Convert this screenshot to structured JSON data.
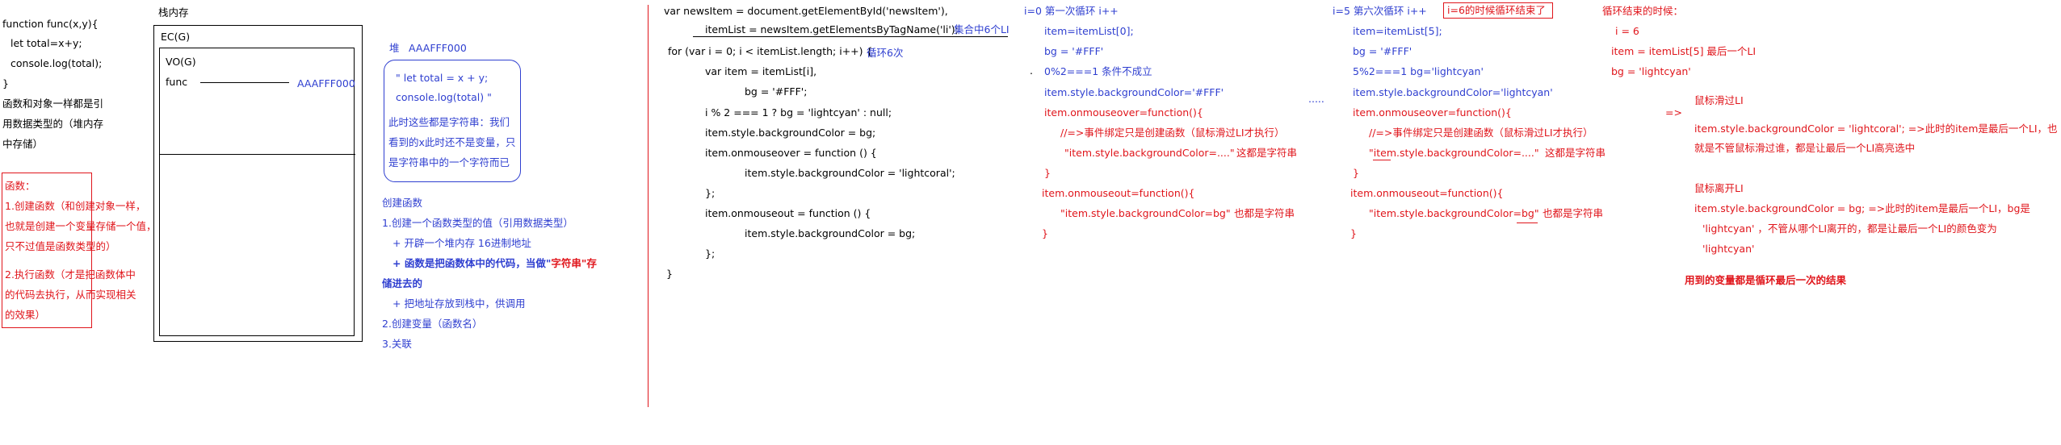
{
  "colors": {
    "text": "#000000",
    "blue": "#2f3fd0",
    "red": "#e0151b"
  },
  "col1": {
    "lines": [
      "function func(x,y){",
      "let total=x+y;",
      "console.log(total);",
      "}",
      "函数和对象一样都是引",
      "用数据类型的（堆内存",
      "中存储）"
    ],
    "box": [
      "函数：",
      "1.创建函数（和创建对象一样，",
      "也就是创建一个变量存储一个值，",
      "只不过值是函数类型的）",
      "2.执行函数（才是把函数体中",
      "的代码去执行，从而实现相关",
      "的效果）"
    ]
  },
  "stack": {
    "title": "栈内存",
    "ec": "EC(G)",
    "vo": "VO(G)",
    "func": "func",
    "addr": "AAAFFF000"
  },
  "heap": {
    "label": "堆",
    "addr": "AAAFFF000",
    "code1": "\" let total = x + y;",
    "code2": "console.log(total) \"",
    "note1": "此时这些都是字符串：我们",
    "note2": "看到的x此时还不是变量，只",
    "note3": "是字符串中的一个字符而已"
  },
  "create": {
    "title": "创建函数",
    "l1": "1.创建一个函数类型的值（引用数据类型）",
    "l2": "+ 开辟一个堆内存   16进制地址",
    "l3a": "+ 函数是把函数体中的代码，当做\"",
    "l3b": "字符串",
    "l3c": "\"存",
    "l4": "储进去的",
    "l5": "+ 把地址存放到栈中，供调用",
    "l6": "2.创建变量（函数名）",
    "l7": "3.关联"
  },
  "code": {
    "l1": "var newsItem = document.getElementById('newsItem'),",
    "l2": "itemList = newsItem.getElementsByTagName('li');",
    "l2note": "集合中6个LI",
    "l3": "for (var i = 0; i < itemList.length; i++) {",
    "l3note": "循环6次",
    "l4": "var item = itemList[i],",
    "l5": "bg = '#FFF';",
    "l6": "i % 2 === 1 ? bg = 'lightcyan' : null;",
    "l7": "item.style.backgroundColor = bg;",
    "l8": "item.onmouseover = function () {",
    "l9": "item.style.backgroundColor = 'lightcoral';",
    "l10": "};",
    "l11": "item.onmouseout = function () {",
    "l12": "item.style.backgroundColor = bg;",
    "l13": "};",
    "l14": "}"
  },
  "loop1": {
    "head": "i=0   第一次循环    i++",
    "l1": "item=itemList[0];",
    "l2": "bg = '#FFF'",
    "dot": ".",
    "l3": "0%2===1 条件不成立",
    "l4": "item.style.backgroundColor='#FFF'",
    "l5": "item.onmouseover=function(){",
    "l6": "//=>事件绑定只是创建函数（鼠标滑过LI才执行）",
    "l7": "\"item.style.backgroundColor=....\"",
    "l7note": "这都是字符串",
    "l8": "}",
    "l9": "item.onmouseout=function(){",
    "l10a": "\"item.style.backgroundColor=bg\"",
    "l10b": "也都是字符串",
    "l11": "}",
    "dots": "....."
  },
  "loop6": {
    "head": "i=5   第六次循环    i++",
    "headBox": "i=6的时候循环结束了",
    "l1": "item=itemList[5];",
    "l2": "bg = '#FFF'",
    "l3": "5%2===1  bg='lightcyan'",
    "l4": "item.style.backgroundColor='lightcyan'",
    "l5": "item.onmouseover=function(){",
    "l6": "//=>事件绑定只是创建函数（鼠标滑过LI才执行）",
    "l7": "\"item.style.backgroundColor=....\"",
    "l7note": "这都是字符串",
    "l8": "}",
    "l9": "item.onmouseout=function(){",
    "l10a": "\"item.style.backgroundColor=bg\"",
    "l10b": "也都是字符串",
    "l11": "}"
  },
  "end": {
    "title": "循环结束的时候：",
    "l1": "i = 6",
    "l2": "item = itemList[5] 最后一个LI",
    "l3": "bg = 'lightcyan'",
    "arrow": "=>",
    "over": "鼠标滑过LI",
    "over1": "item.style.backgroundColor = 'lightcoral';   =>此时的item是最后一个LI，也",
    "over2": "就是不管鼠标滑过谁，都是让最后一个LI高亮选中",
    "out": "鼠标离开LI",
    "out1": "item.style.backgroundColor = bg;    =>此时的item是最后一个LI，bg是",
    "out2": "'lightcyan'   ，不管从哪个LI离开的，都是让最后一个LI的颜色变为",
    "out3": "'lightcyan'",
    "conclusion": "用到的变量都是循环最后一次的结果"
  }
}
